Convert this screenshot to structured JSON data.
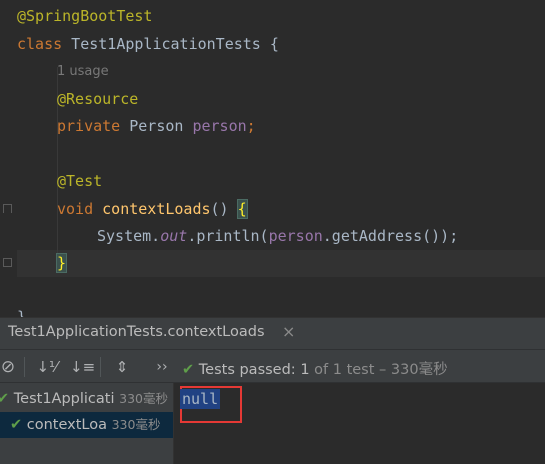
{
  "editor": {
    "line1_annotation": "@SpringBootTest",
    "line2_kw": "class",
    "line2_name": " Test1ApplicationTests {",
    "usage_hint": "1 usage",
    "line4_annotation": "@Resource",
    "line5_kw": "private",
    "line5_type": " Person ",
    "line5_field": "person",
    "line5_end": ";",
    "line7_annotation": "@Test",
    "line8_kw": "void",
    "line8_method": "contextLoads",
    "line8_parens": "() ",
    "line8_brace": "{",
    "line9_system": "System.",
    "line9_out": "out",
    "line9_println": ".println(",
    "line9_person": "person",
    "line9_rest": ".getAddress());",
    "line10_brace": "}",
    "line11_brace": "}"
  },
  "run_panel": {
    "tab_title": "Test1ApplicationTests.contextLoads",
    "tab_close": "×",
    "toolbar": {
      "stop_icon": "⊘",
      "sort_alpha_icon": "↓⅟",
      "sort_duration_icon": "↓≡",
      "collapse_icon": "⇕",
      "more": "››"
    },
    "status_check": "✔",
    "status_label": "Tests passed: ",
    "status_count": "1",
    "status_rest": " of 1 test – 330毫秒",
    "tree": [
      {
        "label": "Test1Applicati",
        "time": "330毫秒"
      },
      {
        "label": "contextLoa",
        "time": "330毫秒"
      }
    ],
    "console_output": "null"
  },
  "colors": {
    "pass_green": "#5f9e4a",
    "highlight_box": "#e53935",
    "selection_blue": "#214283"
  }
}
